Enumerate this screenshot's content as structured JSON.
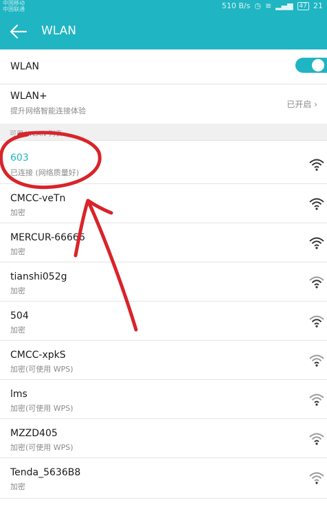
{
  "status_bar": {
    "carrier_1": "中国移动",
    "carrier_2": "中国联通",
    "speed": "510 B/s",
    "battery": "47",
    "time": "21"
  },
  "header": {
    "title": "WLAN",
    "back_icon": "arrow-left-icon"
  },
  "wlan_toggle": {
    "label": "WLAN",
    "enabled": true
  },
  "wlan_plus": {
    "label": "WLAN+",
    "description": "提升网络智能连接体验",
    "status": "已开启"
  },
  "section": {
    "title": "可用 WLAN 列表"
  },
  "networks": [
    {
      "name": "603",
      "detail": "已连接 (网络质量好)",
      "connected": true
    },
    {
      "name": "CMCC-veTn",
      "detail": "加密"
    },
    {
      "name": "MERCUR-66666",
      "detail": "加密"
    },
    {
      "name": "tianshi052g",
      "detail": "加密"
    },
    {
      "name": "504",
      "detail": "加密"
    },
    {
      "name": "CMCC-xpkS",
      "detail": "加密(可使用 WPS)"
    },
    {
      "name": "lms",
      "detail": "加密(可使用 WPS)"
    },
    {
      "name": "MZZD405",
      "detail": "加密(可使用 WPS)"
    },
    {
      "name": "Tenda_5636B8",
      "detail": "加密"
    }
  ],
  "colors": {
    "accent": "#1fb5c2",
    "annotation": "#d8242a"
  }
}
